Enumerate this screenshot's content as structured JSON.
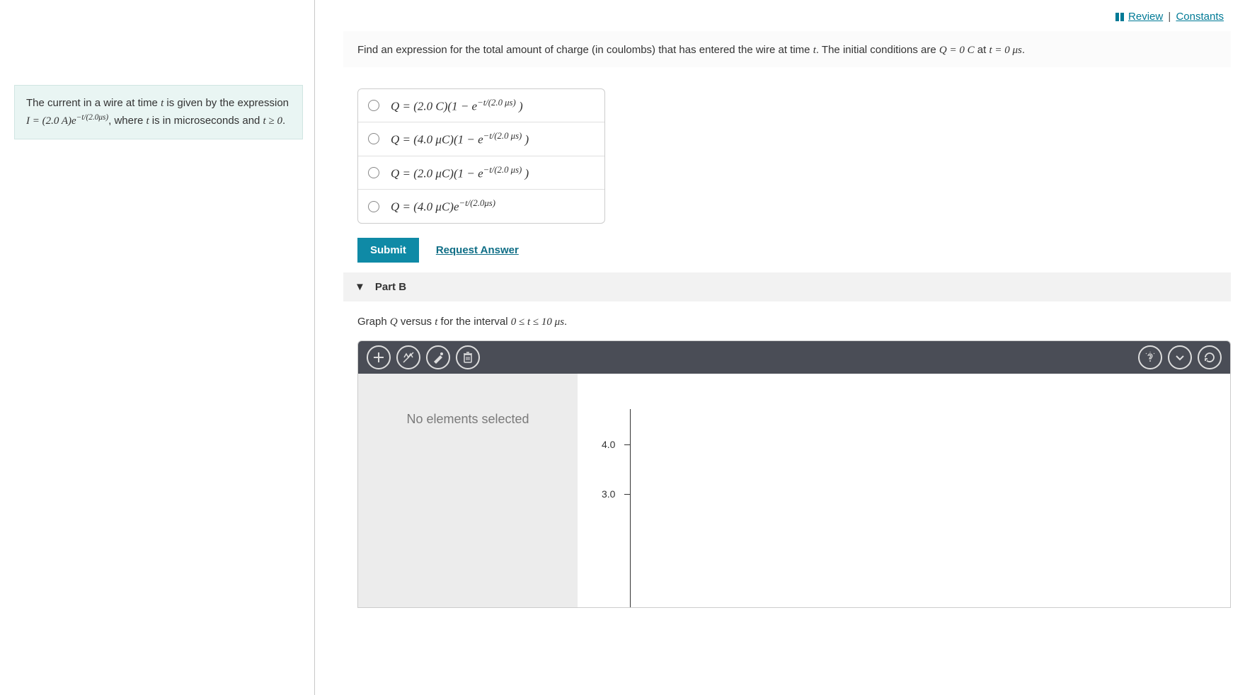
{
  "top_links": {
    "review": "Review",
    "constants": "Constants"
  },
  "problem_statement": {
    "pre": "The current in a wire at time ",
    "t": "t",
    "mid1": " is given by the expression ",
    "expr_lhs": "I = (2.0 A)e",
    "expr_exp": "−t/(2.0μs)",
    "mid2": ", where ",
    "t2": "t",
    "mid3": " is in microseconds and ",
    "cond": "t ≥ 0",
    "end": "."
  },
  "partA": {
    "prompt_pre": "Find an expression for the total amount of charge (in coulombs) that has entered the wire at time ",
    "t": "t",
    "prompt_mid": ". The initial conditions are ",
    "ic": "Q = 0 C",
    "at": " at ",
    "ic_t": "t = 0 μs",
    "end": ".",
    "options": [
      {
        "lhs": "Q = (2.0 C)(1 − e",
        "exp": "−t/(2.0 μs)",
        "rhs": " )"
      },
      {
        "lhs": "Q = (4.0 μC)(1 − e",
        "exp": "−t/(2.0 μs)",
        "rhs": " )"
      },
      {
        "lhs": "Q = (2.0 μC)(1 − e",
        "exp": "−t/(2.0 μs)",
        "rhs": " )"
      },
      {
        "lhs": "Q = (4.0 μC)e",
        "exp": "−t/(2.0μs)",
        "rhs": ""
      }
    ],
    "submit": "Submit",
    "request": "Request Answer"
  },
  "partB": {
    "header": "Part B",
    "prompt_pre": "Graph ",
    "Q": "Q",
    "prompt_mid1": " versus ",
    "t": "t",
    "prompt_mid2": " for the interval ",
    "range": "0 ≤ t ≤ 10 μs",
    "end": ".",
    "no_selection": "No elements selected",
    "yticks": [
      "4.0",
      "3.0"
    ]
  },
  "icons": {
    "add": "add-icon",
    "no-vertex": "no-vertex-icon",
    "edit-point": "edit-point-icon",
    "delete": "delete-icon",
    "hint": "hint-icon",
    "expand": "expand-icon",
    "reset": "reset-icon"
  }
}
